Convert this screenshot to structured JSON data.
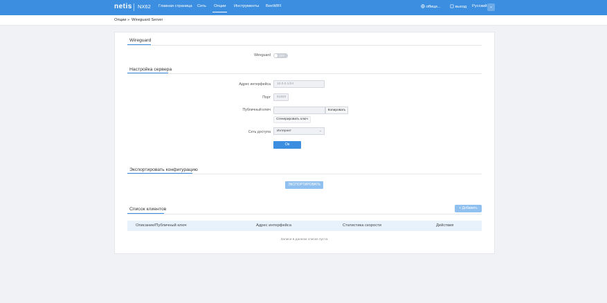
{
  "header": {
    "logo": "netis",
    "model": "NX62",
    "nav": [
      "Главная страница",
      "Сеть",
      "Опции",
      "Инструменты",
      "BeeWIFI"
    ],
    "active_nav": "Опции",
    "official_label": "offици...",
    "logout_label": "выход",
    "language": "Русский",
    "icons": {
      "official": "globe-icon",
      "logout": "logout-icon",
      "language_dropdown": "chevron-down-icon"
    }
  },
  "breadcrumb": {
    "parent": "Опции",
    "separator": "»",
    "current": "Wireguard Server"
  },
  "wireguard": {
    "section_title": "Wireguard",
    "toggle_label": "Wireguard",
    "toggle_state": "OFF"
  },
  "server": {
    "section_title": "Настройка сервера",
    "interface_label": "Адрес интерфейса",
    "interface_value": "10.0.0.1/24",
    "port_label": "Порт",
    "port_value": "51820",
    "pubkey_label": "Публичный ключ",
    "pubkey_value": "",
    "copy_button": "Копировать",
    "generate_button": "Сгенерировать ключ",
    "access_label": "Сеть доступа",
    "access_value": "Интернет",
    "ok_button": "Ок"
  },
  "export": {
    "section_title": "Экспортировать конфигурацию",
    "button": "ЭКСПОРТИРОВАТЬ"
  },
  "clients": {
    "section_title": "Список клиентов",
    "add_button": "+ Добавить",
    "columns": [
      "Описание/Публичный ключ",
      "Адрес интерфейса",
      "Статистика скорости",
      "Действия"
    ],
    "empty_message": "Записи в данном списке пуста."
  },
  "colors": {
    "primary": "#3b8ee0",
    "primary_light": "#8fc0ef",
    "table_header": "#e8f2fc",
    "background": "#f0f2f5"
  }
}
